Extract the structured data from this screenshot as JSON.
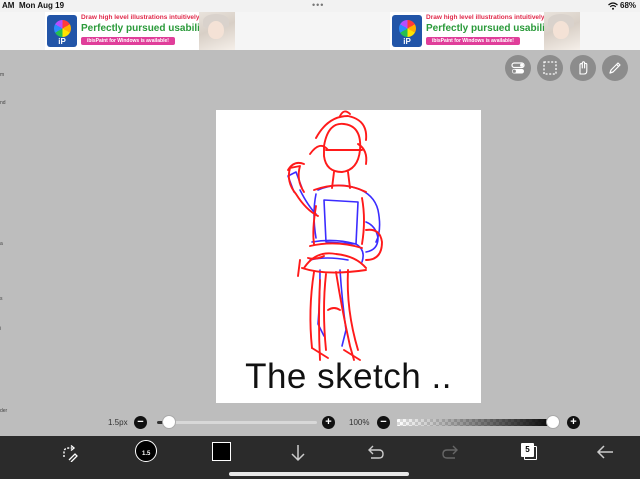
{
  "status_bar": {
    "time": "AM",
    "date": "Mon Aug 19",
    "dots": "•••",
    "battery": "68%"
  },
  "ads": [
    {
      "logo_text": "iP",
      "line1": "Draw high level illustrations intuitively!",
      "line2": "Perfectly pursued usability!",
      "line3": "ibisPaint for Windows is available!"
    },
    {
      "logo_text": "iP",
      "line1": "Draw high level illustrations intuitively!",
      "line2": "Perfectly pursued usability!",
      "line3": "ibisPaint for Windows is available!"
    }
  ],
  "edge_labels": [
    "m",
    "nd",
    "a",
    "s",
    "i",
    "der",
    "per"
  ],
  "canvas": {
    "caption": "The sketch .."
  },
  "brush": {
    "size_label": "1.5px",
    "size_fraction": 0.05,
    "opacity_label": "100%",
    "opacity_fraction": 1.0,
    "minus": "−",
    "plus": "+"
  },
  "toolbar": {
    "brush_size_text": "1.5",
    "layer_count": "5",
    "color": "#000000"
  },
  "colors": {
    "sketch_red": "#ff1a1a",
    "sketch_blue": "#3b2cff",
    "toolbar_bg": "#2b2b2b",
    "workspace_bg": "#bdbdbd"
  },
  "icons": {
    "status": [
      "wifi-icon"
    ],
    "top_tools": [
      "toggle-icon",
      "selection-icon",
      "hand-icon",
      "pen-icon"
    ],
    "bottom_tools": [
      "transform-tool-icon",
      "brush-icon",
      "color-icon",
      "download-icon",
      "undo-icon",
      "redo-icon",
      "layers-icon",
      "back-arrow-icon"
    ]
  }
}
